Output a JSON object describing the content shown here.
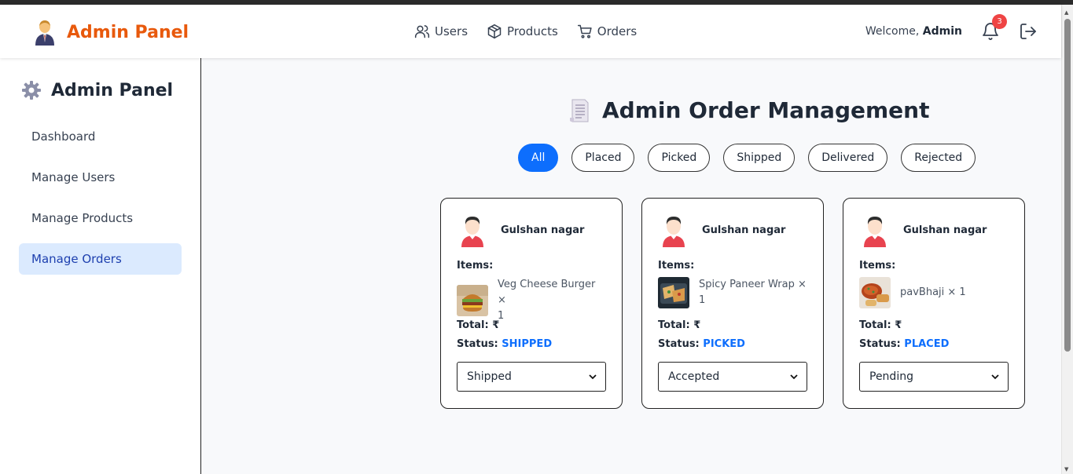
{
  "header": {
    "brand": "Admin Panel",
    "nav": [
      {
        "label": "Users",
        "icon": "users-icon"
      },
      {
        "label": "Products",
        "icon": "box-icon"
      },
      {
        "label": "Orders",
        "icon": "cart-icon"
      }
    ],
    "welcome_prefix": "Welcome,",
    "welcome_user": "Admin",
    "notification_count": "3"
  },
  "sidebar": {
    "title": "Admin Panel",
    "items": [
      {
        "label": "Dashboard"
      },
      {
        "label": "Manage Users"
      },
      {
        "label": "Manage Products"
      },
      {
        "label": "Manage Orders",
        "active": true
      }
    ]
  },
  "main": {
    "title": "Admin Order Management",
    "filters": [
      "All",
      "Placed",
      "Picked",
      "Shipped",
      "Delivered",
      "Rejected"
    ],
    "active_filter": "All",
    "orders": [
      {
        "customer": "Gulshan nagar",
        "items_label": "Items:",
        "item_text_1": "Veg Cheese Burger ×",
        "item_text_2": "1",
        "total_label": "Total:",
        "currency": "₹",
        "status_label": "Status:",
        "status": "SHIPPED",
        "select_value": "Shipped"
      },
      {
        "customer": "Gulshan nagar",
        "items_label": "Items:",
        "item_text_1": "Spicy Paneer Wrap ×",
        "item_text_2": "1",
        "total_label": "Total:",
        "currency": "₹",
        "status_label": "Status:",
        "status": "PICKED",
        "select_value": "Accepted"
      },
      {
        "customer": "Gulshan nagar",
        "items_label": "Items:",
        "item_text_1": "pavBhaji × 1",
        "item_text_2": "",
        "total_label": "Total:",
        "currency": "₹",
        "status_label": "Status:",
        "status": "PLACED",
        "select_value": "Pending"
      }
    ]
  },
  "colors": {
    "brand": "#e8590c",
    "accent": "#0d6efd",
    "active_bg": "#dbeafe",
    "badge": "#ef4444"
  }
}
